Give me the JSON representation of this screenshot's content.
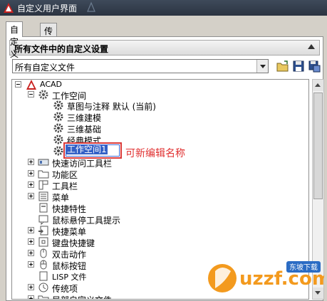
{
  "window": {
    "title": "自定义用户界面"
  },
  "tabs": [
    {
      "label": "自定义"
    },
    {
      "label": "传输"
    }
  ],
  "section": {
    "title": "所有文件中的自定义设置"
  },
  "file_selector": {
    "value": "所有自定义文件"
  },
  "tree": {
    "root": "ACAD",
    "workspaces": "工作空间",
    "ws_items": [
      "草图与注释 默认 (当前)",
      "三维建模",
      "三维基础",
      "经典模式"
    ],
    "editing_value": "工作空间1",
    "items": [
      "快速访问工具栏",
      "功能区",
      "工具栏",
      "菜单",
      "快捷特性",
      "鼠标悬停工具提示",
      "快捷菜单",
      "键盘快捷键",
      "双击动作",
      "鼠标按钮",
      "LISP 文件",
      "传统项",
      "局部自定义文件"
    ]
  },
  "annotation": {
    "text": "可新编辑名称"
  },
  "watermark": {
    "brand": "uzzf.com",
    "badge": "东坡下载"
  },
  "colors": {
    "annotation": "#e03030",
    "selection": "#3360c6",
    "acad_red": "#c8201e"
  }
}
